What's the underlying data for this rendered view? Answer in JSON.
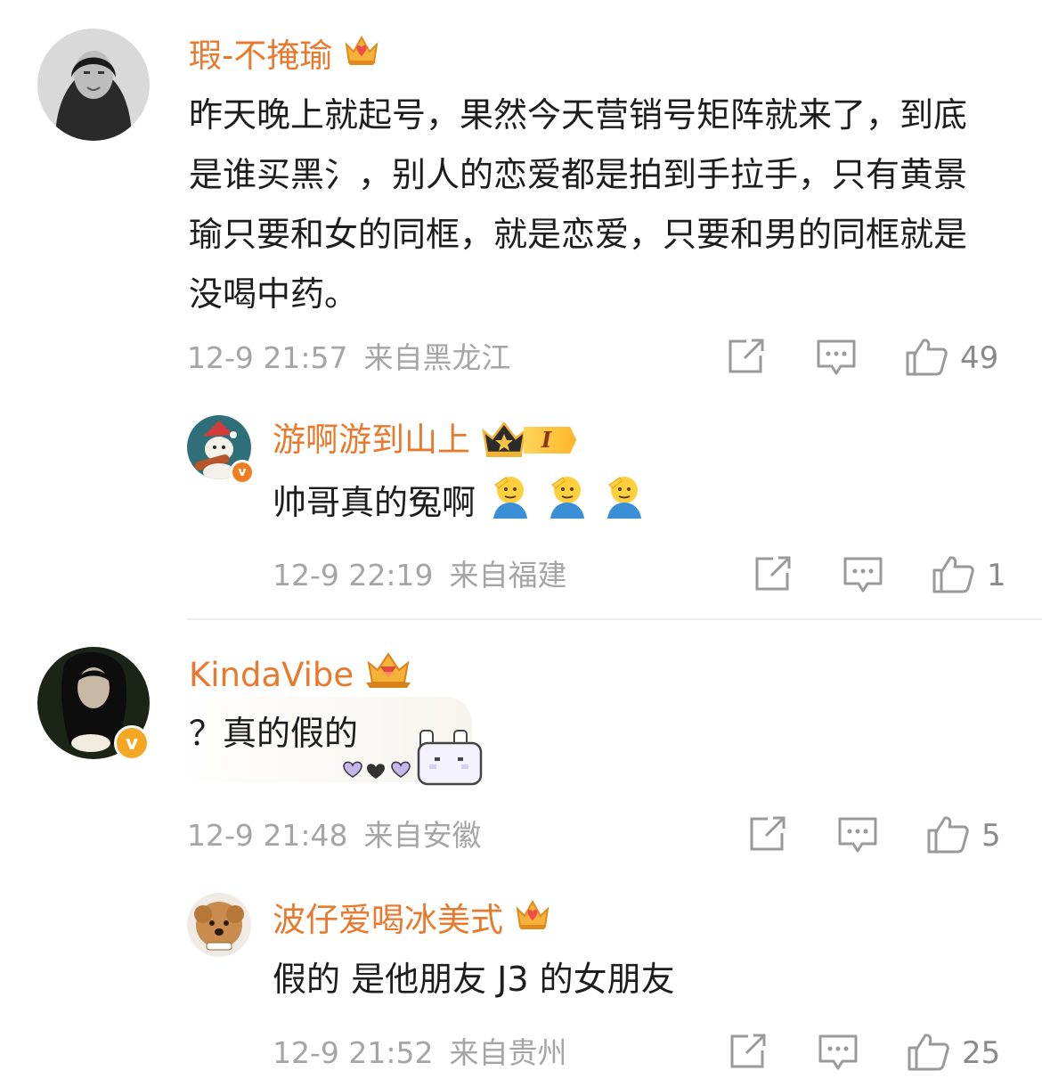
{
  "comments": [
    {
      "username": "瑕-不掩瑜",
      "badge_icon": "crown-heart-badge-icon",
      "text": "昨天晚上就起号，果然今天营销号矩阵就来了，到底是谁买黑氵，别人的恋爱都是拍到手拉手，只有黄景瑜只要和女的同框，就是恋爱，只要和男的同框就是没喝中药。",
      "date": "12-9 21:57",
      "location": "来自黑龙江",
      "likes": "49",
      "replies": [
        {
          "username": "游啊游到山上",
          "badge_icon": "crown-level-badge-icon",
          "level_badge": "I",
          "verified": "v",
          "text": "帅哥真的冤啊",
          "emojis": [
            "salute-emoji-icon",
            "salute-emoji-icon",
            "salute-emoji-icon"
          ],
          "date": "12-9 22:19",
          "location": "来自福建",
          "likes": "1"
        }
      ]
    },
    {
      "username": "KindaVibe",
      "badge_icon": "crown-gem-badge-icon",
      "verified": "v",
      "text": "？真的假的",
      "sticker": "pixel-bunny-hearts-sticker",
      "date": "12-9 21:48",
      "location": "来自安徽",
      "likes": "5",
      "replies": [
        {
          "username": "波仔爱喝冰美式",
          "badge_icon": "crown-heart-badge-icon",
          "text": "假的 是他朋友 J3 的女朋友",
          "date": "12-9 21:52",
          "location": "来自贵州",
          "likes": "25"
        }
      ]
    }
  ],
  "colors": {
    "username": "#e8792d",
    "meta": "#a5a5a5",
    "badge_gold": "#f5a623"
  }
}
